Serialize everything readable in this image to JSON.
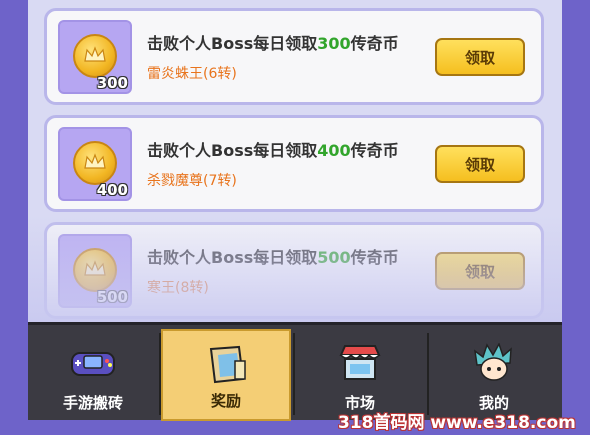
{
  "rewards": [
    {
      "amount": "300",
      "title_prefix": "击败个人Boss每日领取",
      "title_num": "300",
      "title_suffix": "传奇币",
      "subtitle": "雷炎蛛王(6转)",
      "button": "领取"
    },
    {
      "amount": "400",
      "title_prefix": "击败个人Boss每日领取",
      "title_num": "400",
      "title_suffix": "传奇币",
      "subtitle": "杀戮魔尊(7转)",
      "button": "领取"
    },
    {
      "amount": "500",
      "title_prefix": "击败个人Boss每日领取",
      "title_num": "500",
      "title_suffix": "传奇币",
      "subtitle": "寒王(8转)",
      "button": "领取"
    }
  ],
  "tabs": [
    {
      "label": "手游搬砖",
      "icon": "gamepad-icon"
    },
    {
      "label": "奖励",
      "icon": "reward-scroll-icon"
    },
    {
      "label": "市场",
      "icon": "market-stall-icon"
    },
    {
      "label": "我的",
      "icon": "avatar-icon"
    }
  ],
  "watermark": "318首码网 www.e318.com",
  "colors": {
    "accent_green": "#32a52c",
    "subtitle_orange": "#e8741d",
    "button_yellow": "#f5bf1f",
    "background_purple": "#6e63c9"
  }
}
